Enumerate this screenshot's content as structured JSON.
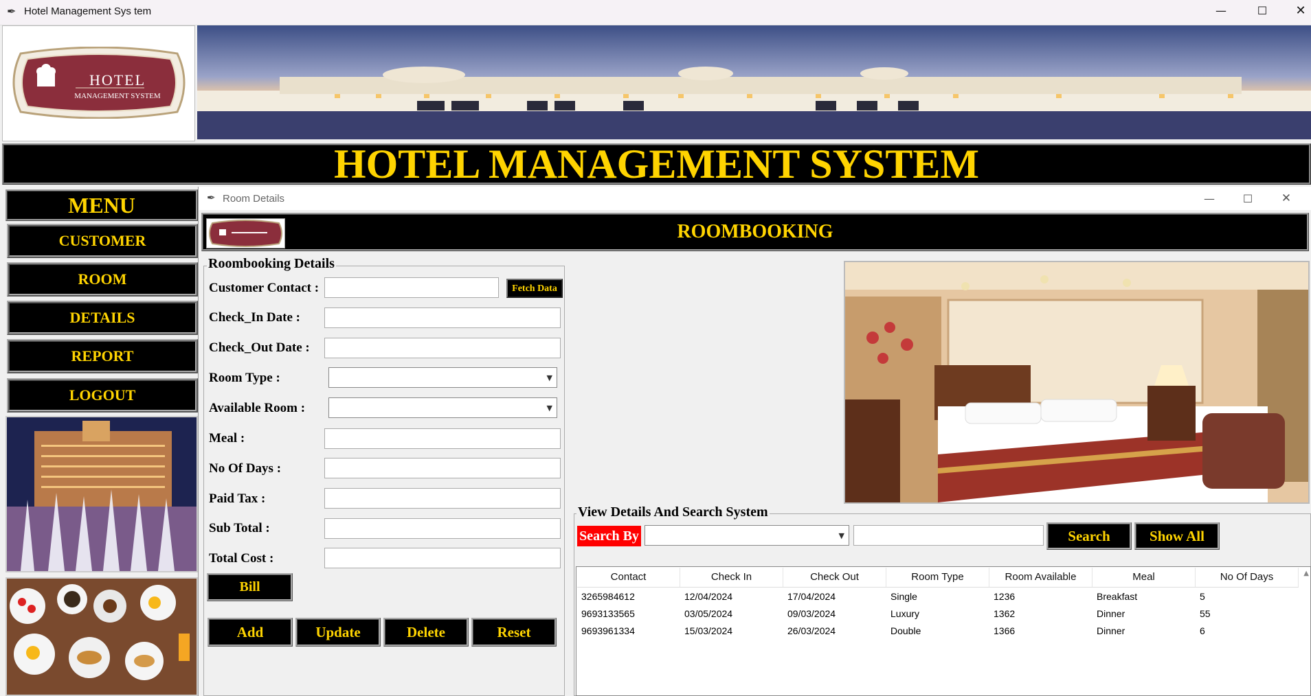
{
  "window": {
    "title": "Hotel Management Sys tem",
    "controls": [
      "—",
      "☐",
      "✕"
    ]
  },
  "logo": {
    "line1": "HOTEL",
    "line2": "MANAGEMENT SYSTEM"
  },
  "header": {
    "title": "HOTEL MANAGEMENT SYSTEM"
  },
  "menu": {
    "title": "MENU",
    "items": [
      "CUSTOMER",
      "ROOM",
      "DETAILS",
      "REPORT",
      "LOGOUT"
    ]
  },
  "child_window": {
    "title": "Room Details",
    "banner_title": "ROOMBOOKING"
  },
  "booking_form": {
    "legend": "Roombooking Details",
    "fields": {
      "contact": {
        "label": "Customer Contact :",
        "value": ""
      },
      "checkin": {
        "label": "Check_In Date :",
        "value": ""
      },
      "checkout": {
        "label": "Check_Out Date :",
        "value": ""
      },
      "roomtype": {
        "label": "Room Type :",
        "value": ""
      },
      "available": {
        "label": "Available Room :",
        "value": ""
      },
      "meal": {
        "label": "Meal :",
        "value": ""
      },
      "days": {
        "label": "No Of Days :",
        "value": ""
      },
      "tax": {
        "label": "Paid Tax :",
        "value": ""
      },
      "subtotal": {
        "label": "Sub Total :",
        "value": ""
      },
      "total": {
        "label": "Total Cost :",
        "value": ""
      }
    },
    "fetch_label": "Fetch Data",
    "bill_label": "Bill",
    "actions": {
      "add": "Add",
      "update": "Update",
      "delete": "Delete",
      "reset": "Reset"
    }
  },
  "search": {
    "legend": "View Details And Search System",
    "search_by_label": "Search By",
    "search_by_value": "",
    "search_text": "",
    "search_label": "Search",
    "show_all_label": "Show All"
  },
  "table": {
    "columns": [
      "Contact",
      "Check In",
      "Check Out",
      "Room Type",
      "Room Available",
      "Meal",
      "No Of Days"
    ],
    "rows": [
      [
        "3265984612",
        "12/04/2024",
        "17/04/2024",
        "Single",
        "1236",
        "Breakfast",
        "5"
      ],
      [
        "9693133565",
        "03/05/2024",
        "09/03/2024",
        "Luxury",
        "1362",
        "Dinner",
        "55"
      ],
      [
        "9693961334",
        "15/03/2024",
        "26/03/2024",
        "Double",
        "1366",
        "Dinner",
        "6"
      ]
    ]
  },
  "colors": {
    "accent_yellow": "#ffd400",
    "black": "#000000",
    "search_red": "#ff0000",
    "logo_maroon": "#8b2e3c"
  }
}
